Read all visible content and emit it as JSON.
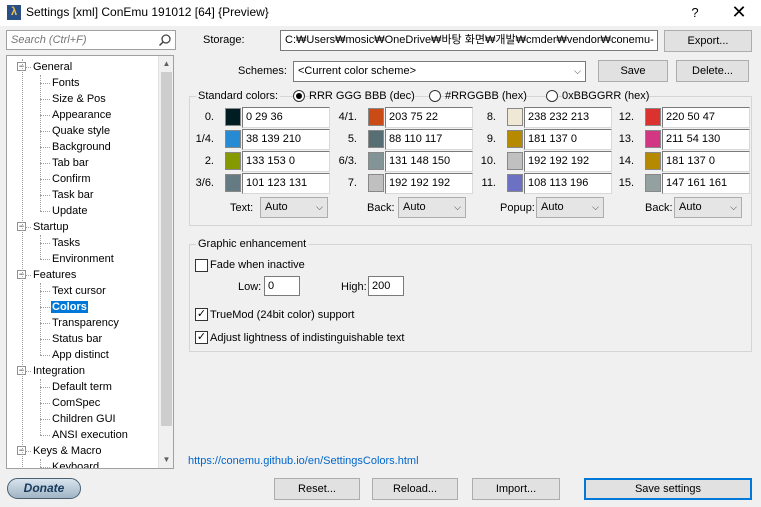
{
  "window": {
    "title": "Settings [xml] ConEmu 191012 [64] {Preview}",
    "icon_glyph": "λ",
    "help_glyph": "?",
    "close_glyph": "✕"
  },
  "search": {
    "placeholder": "Search (Ctrl+F)"
  },
  "tree": {
    "items": [
      {
        "label": "General",
        "level": 0,
        "expander": "−"
      },
      {
        "label": "Fonts",
        "level": 1
      },
      {
        "label": "Size & Pos",
        "level": 1
      },
      {
        "label": "Appearance",
        "level": 1
      },
      {
        "label": "Quake style",
        "level": 1
      },
      {
        "label": "Background",
        "level": 1
      },
      {
        "label": "Tab bar",
        "level": 1
      },
      {
        "label": "Confirm",
        "level": 1
      },
      {
        "label": "Task bar",
        "level": 1
      },
      {
        "label": "Update",
        "level": 1
      },
      {
        "label": "Startup",
        "level": 0,
        "expander": "−"
      },
      {
        "label": "Tasks",
        "level": 1
      },
      {
        "label": "Environment",
        "level": 1
      },
      {
        "label": "Features",
        "level": 0,
        "expander": "−"
      },
      {
        "label": "Text cursor",
        "level": 1
      },
      {
        "label": "Colors",
        "level": 1,
        "selected": true
      },
      {
        "label": "Transparency",
        "level": 1
      },
      {
        "label": "Status bar",
        "level": 1
      },
      {
        "label": "App distinct",
        "level": 1
      },
      {
        "label": "Integration",
        "level": 0,
        "expander": "−"
      },
      {
        "label": "Default term",
        "level": 1
      },
      {
        "label": "ComSpec",
        "level": 1
      },
      {
        "label": "Children GUI",
        "level": 1
      },
      {
        "label": "ANSI execution",
        "level": 1
      },
      {
        "label": "Keys & Macro",
        "level": 0,
        "expander": "−"
      },
      {
        "label": "Keyboard",
        "level": 1
      }
    ]
  },
  "donate_label": "Donate",
  "storage": {
    "label": "Storage:",
    "value": "C:₩Users₩mosic₩OneDrive₩바탕 화면₩개발₩cmder₩vendor₩conemu-",
    "export_label": "Export..."
  },
  "schemes": {
    "label": "Schemes:",
    "selected": "<Current color scheme>",
    "save_label": "Save",
    "delete_label": "Delete..."
  },
  "format": {
    "label": "Standard colors:",
    "options": [
      "RRR GGG BBB (dec)",
      "#RRGGBB (hex)",
      "0xBBGGRR (hex)"
    ],
    "selected_index": 0
  },
  "colors": [
    {
      "index": "0.",
      "hex": "#001d24",
      "value": "0 29 36"
    },
    {
      "index": "1/4.",
      "hex": "#268bd2",
      "value": "38 139 210"
    },
    {
      "index": "2.",
      "hex": "#859900",
      "value": "133 153 0"
    },
    {
      "index": "3/6.",
      "hex": "#657b83",
      "value": "101 123 131"
    },
    {
      "index": "4/1.",
      "hex": "#cb4b16",
      "value": "203 75 22"
    },
    {
      "index": "5.",
      "hex": "#586e75",
      "value": "88 110 117"
    },
    {
      "index": "6/3.",
      "hex": "#839496",
      "value": "131 148 150"
    },
    {
      "index": "7.",
      "hex": "#c0c0c0",
      "value": "192 192 192"
    },
    {
      "index": "8.",
      "hex": "#eee8d5",
      "value": "238 232 213"
    },
    {
      "index": "9.",
      "hex": "#b58900",
      "value": "181 137 0"
    },
    {
      "index": "10.",
      "hex": "#c0c0c0",
      "value": "192 192 192"
    },
    {
      "index": "11.",
      "hex": "#6c71c4",
      "value": "108 113 196"
    },
    {
      "index": "12.",
      "hex": "#dc322f",
      "value": "220 50 47"
    },
    {
      "index": "13.",
      "hex": "#d33682",
      "value": "211 54 130"
    },
    {
      "index": "14.",
      "hex": "#b58900",
      "value": "181 137 0"
    },
    {
      "index": "15.",
      "hex": "#93a1a1",
      "value": "147 161 161"
    }
  ],
  "selectors": [
    {
      "label": "Text:",
      "value": "Auto"
    },
    {
      "label": "Back:",
      "value": "Auto"
    },
    {
      "label": "Popup:",
      "value": "Auto"
    },
    {
      "label": "Back:",
      "value": "Auto"
    }
  ],
  "graphic": {
    "label": "Graphic enhancement",
    "fade_label": "Fade when inactive",
    "fade_checked": false,
    "low_label": "Low:",
    "low_value": "0",
    "high_label": "High:",
    "high_value": "200",
    "truemod_label": "TrueMod (24bit color) support",
    "truemod_checked": true,
    "adjust_label": "Adjust lightness of indistinguishable text",
    "adjust_checked": true
  },
  "help_link": "https://conemu.github.io/en/SettingsColors.html",
  "buttons": {
    "reset": "Reset...",
    "reload": "Reload...",
    "import": "Import...",
    "save_settings": "Save settings"
  }
}
